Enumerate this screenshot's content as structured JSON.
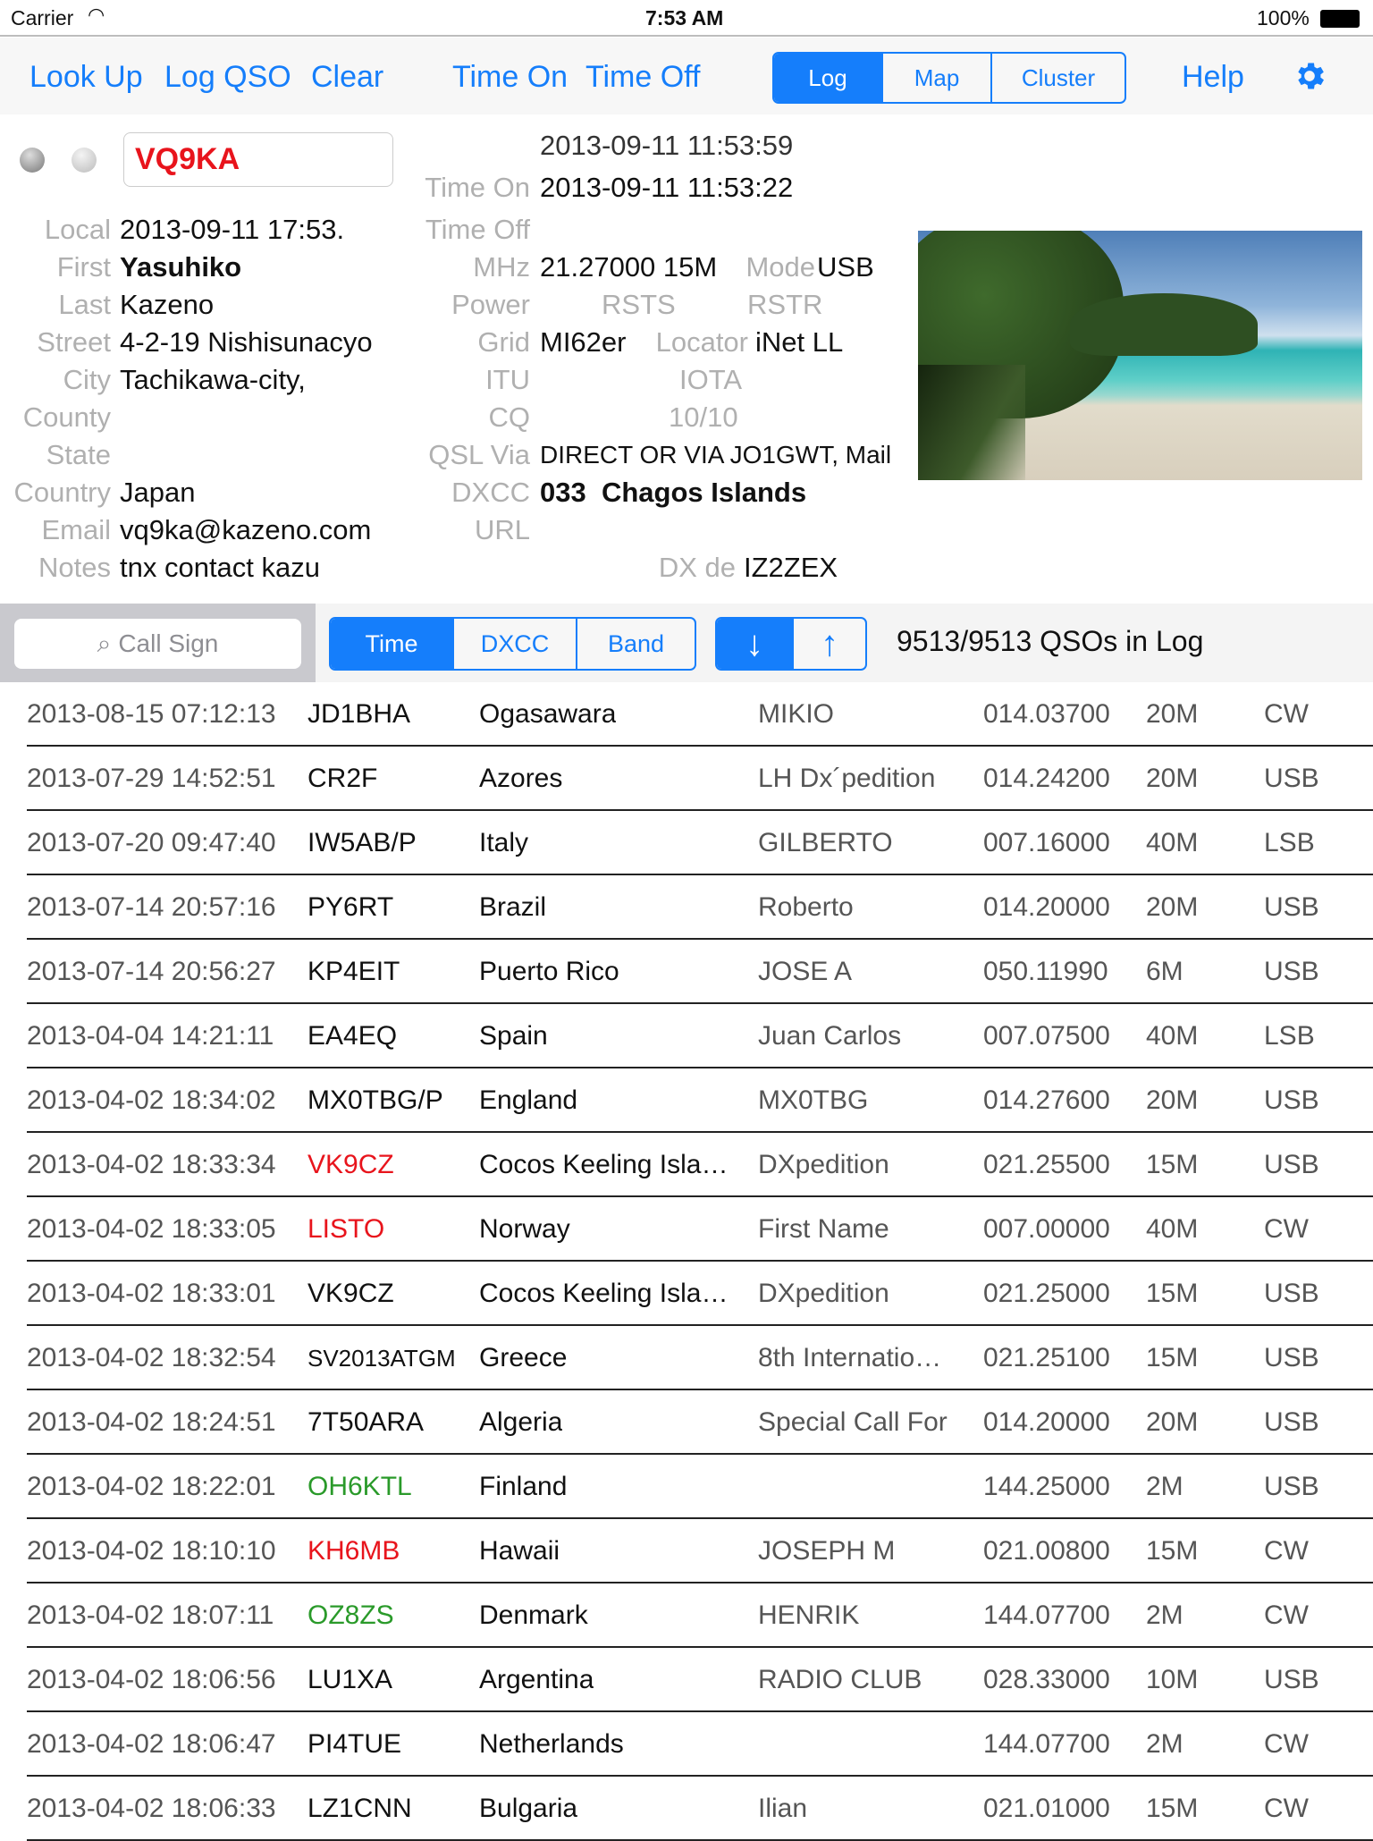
{
  "status_bar": {
    "carrier": "Carrier",
    "time": "7:53 AM",
    "battery": "100%"
  },
  "toolbar": {
    "look_up": "Look Up",
    "log_qso": "Log QSO",
    "clear": "Clear",
    "time_on": "Time On",
    "time_off": "Time Off",
    "views": [
      {
        "label": "Log",
        "selected": true
      },
      {
        "label": "Map",
        "selected": false
      },
      {
        "label": "Cluster",
        "selected": false
      }
    ],
    "help": "Help",
    "accent": "#157efb"
  },
  "qso": {
    "call": "VQ9KA",
    "utc_now": "2013-09-11 11:53:59",
    "left": [
      {
        "label": "Local",
        "value": "2013-09-11 17:53."
      },
      {
        "label": "First",
        "value": "Yasuhiko"
      },
      {
        "label": "Last",
        "value": "Kazeno"
      },
      {
        "label": "Street",
        "value": "4-2-19 Nishisunacyo"
      },
      {
        "label": "City",
        "value": "Tachikawa-city,"
      },
      {
        "label": "County",
        "value": ""
      },
      {
        "label": "State",
        "value": ""
      },
      {
        "label": "Country",
        "value": "Japan"
      },
      {
        "label": "Email",
        "value": "vq9ka@kazeno.com"
      },
      {
        "label": "Notes",
        "value": "tnx contact kazu"
      }
    ],
    "time_on_label": "Time On",
    "time_on": "2013-09-11 11:53:22",
    "time_off_label": "Time Off",
    "mhz_label": "MHz",
    "mhz": "21.27000 15M",
    "mode_label": "Mode",
    "mode": "USB",
    "power_label": "Power",
    "rsts_label": "RSTS",
    "rstr_label": "RSTR",
    "grid_label": "Grid",
    "grid": "MI62er",
    "locator_label": "Locator",
    "locator": "iNet LL",
    "itu_label": "ITU",
    "iota_label": "IOTA",
    "cq_label": "CQ",
    "cq_count": "10/10",
    "qsl_label": "QSL Via",
    "qsl": "DIRECT OR VIA JO1GWT, Mail",
    "dxcc_label": "DXCC",
    "dxcc": "033  Chagos Islands",
    "url_label": "URL",
    "dxde_label": "DX de",
    "dxde": "IZ2ZEX"
  },
  "search": {
    "placeholder": "Call Sign"
  },
  "sort": {
    "options": [
      {
        "label": "Time",
        "selected": true
      },
      {
        "label": "DXCC",
        "selected": false
      },
      {
        "label": "Band",
        "selected": false
      }
    ]
  },
  "log_count": "9513/9513 QSOs in Log",
  "colors": {
    "red": "#e8141c",
    "green": "#2a9a2a",
    "grey": "#555555"
  },
  "log": [
    {
      "time": "2013-08-15 07:12:13",
      "call": "JD1BHA",
      "color": "",
      "country": "Ogasawara",
      "name": "MIKIO",
      "freq": "014.03700",
      "band": "20M",
      "mode": "CW"
    },
    {
      "time": "2013-07-29 14:52:51",
      "call": "CR2F",
      "color": "",
      "country": "Azores",
      "name": "LH Dx´pedition",
      "freq": "014.24200",
      "band": "20M",
      "mode": "USB"
    },
    {
      "time": "2013-07-20 09:47:40",
      "call": "IW5AB/P",
      "color": "",
      "country": "Italy",
      "name": "GILBERTO",
      "freq": "007.16000",
      "band": "40M",
      "mode": "LSB"
    },
    {
      "time": "2013-07-14 20:57:16",
      "call": "PY6RT",
      "color": "",
      "country": "Brazil",
      "name": "Roberto",
      "freq": "014.20000",
      "band": "20M",
      "mode": "USB"
    },
    {
      "time": "2013-07-14 20:56:27",
      "call": "KP4EIT",
      "color": "",
      "country": "Puerto Rico",
      "name": "JOSE A",
      "freq": "050.11990",
      "band": "6M",
      "mode": "USB"
    },
    {
      "time": "2013-04-04 14:21:11",
      "call": "EA4EQ",
      "color": "",
      "country": "Spain",
      "name": "Juan Carlos",
      "freq": "007.07500",
      "band": "40M",
      "mode": "LSB"
    },
    {
      "time": "2013-04-02 18:34:02",
      "call": "MX0TBG/P",
      "color": "",
      "country": "England",
      "name": "MX0TBG",
      "freq": "014.27600",
      "band": "20M",
      "mode": "USB"
    },
    {
      "time": "2013-04-02 18:33:34",
      "call": "VK9CZ",
      "color": "red",
      "country": "Cocos Keeling Isla…",
      "name": "DXpedition",
      "freq": "021.25500",
      "band": "15M",
      "mode": "USB"
    },
    {
      "time": "2013-04-02 18:33:05",
      "call": "LISTO",
      "color": "red",
      "country": "Norway",
      "name": "First Name",
      "freq": "007.00000",
      "band": "40M",
      "mode": "CW"
    },
    {
      "time": "2013-04-02 18:33:01",
      "call": "VK9CZ",
      "color": "",
      "country": "Cocos Keeling Isla…",
      "name": "DXpedition",
      "freq": "021.25000",
      "band": "15M",
      "mode": "USB"
    },
    {
      "time": "2013-04-02 18:32:54",
      "call": "SV2013ATGM",
      "color": "",
      "country": "Greece",
      "name": "8th Internatio…",
      "freq": "021.25100",
      "band": "15M",
      "mode": "USB"
    },
    {
      "time": "2013-04-02 18:24:51",
      "call": "7T50ARA",
      "color": "",
      "country": "Algeria",
      "name": "Special Call For",
      "freq": "014.20000",
      "band": "20M",
      "mode": "USB"
    },
    {
      "time": "2013-04-02 18:22:01",
      "call": "OH6KTL",
      "color": "green",
      "country": "Finland",
      "name": "",
      "freq": "144.25000",
      "band": "2M",
      "mode": "USB"
    },
    {
      "time": "2013-04-02 18:10:10",
      "call": "KH6MB",
      "color": "red",
      "country": "Hawaii",
      "name": "JOSEPH M",
      "freq": "021.00800",
      "band": "15M",
      "mode": "CW"
    },
    {
      "time": "2013-04-02 18:07:11",
      "call": "OZ8ZS",
      "color": "green",
      "country": "Denmark",
      "name": "HENRIK",
      "freq": "144.07700",
      "band": "2M",
      "mode": "CW"
    },
    {
      "time": "2013-04-02 18:06:56",
      "call": "LU1XA",
      "color": "",
      "country": "Argentina",
      "name": "RADIO CLUB",
      "freq": "028.33000",
      "band": "10M",
      "mode": "USB"
    },
    {
      "time": "2013-04-02 18:06:47",
      "call": "PI4TUE",
      "color": "",
      "country": "Netherlands",
      "name": "",
      "freq": "144.07700",
      "band": "2M",
      "mode": "CW"
    },
    {
      "time": "2013-04-02 18:06:33",
      "call": "LZ1CNN",
      "color": "",
      "country": "Bulgaria",
      "name": "Ilian",
      "freq": "021.01000",
      "band": "15M",
      "mode": "CW"
    }
  ]
}
